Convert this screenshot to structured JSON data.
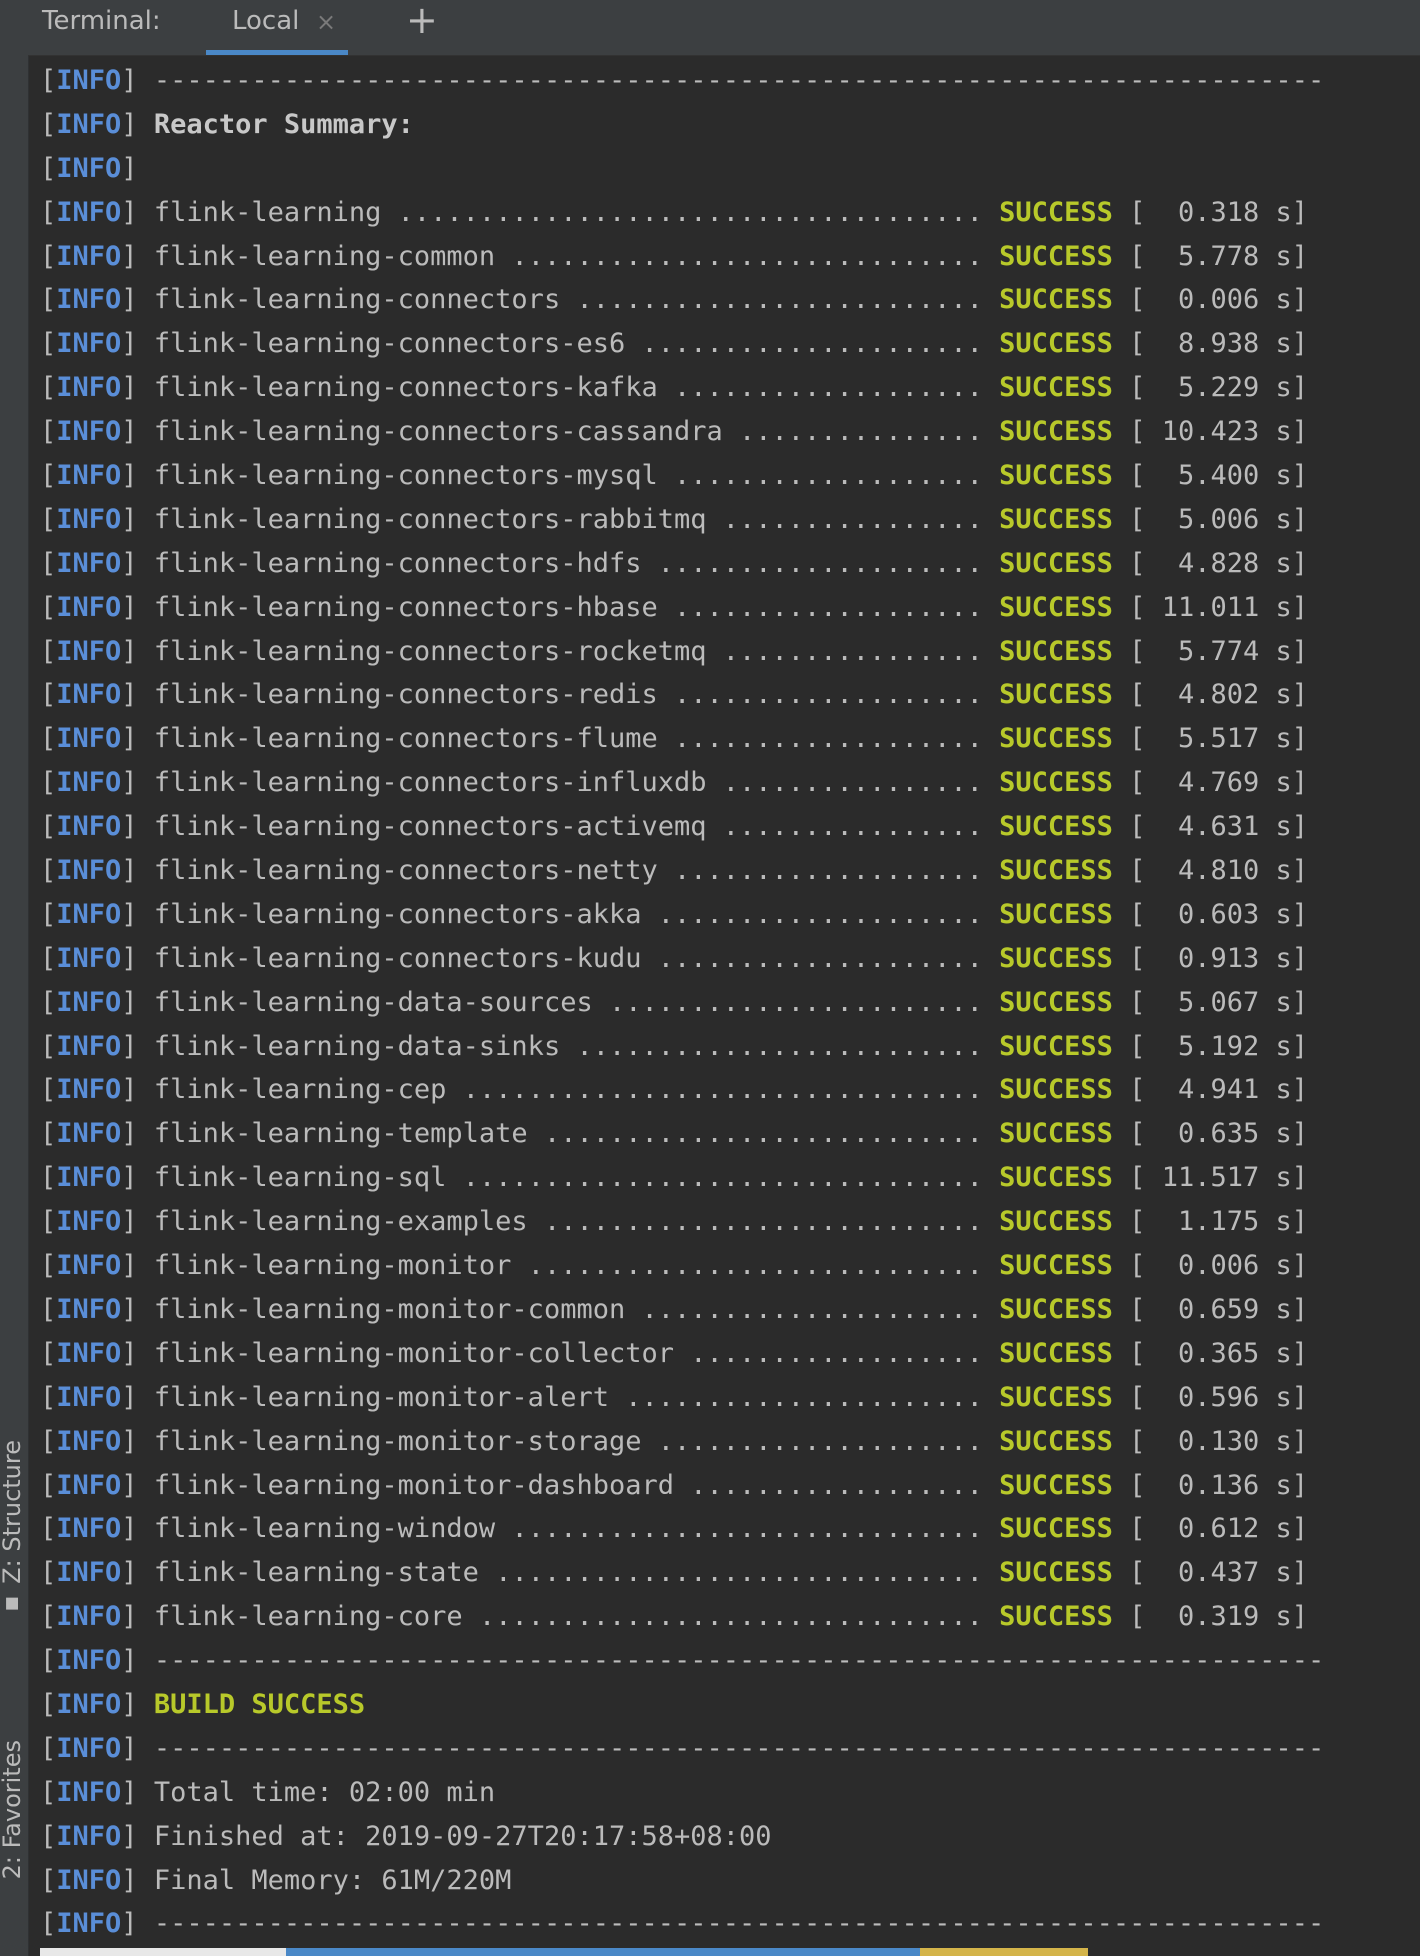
{
  "sidebar": {
    "structure_label": "Z: Structure",
    "favorites_label": "2: Favorites"
  },
  "tabbar": {
    "title": "Terminal:",
    "tab_label": "Local",
    "close_glyph": "×",
    "add_glyph": "+"
  },
  "console": {
    "info_tag": "INFO",
    "separator": "------------------------------------------------------------------------",
    "reactor_summary": "Reactor Summary:",
    "status": "SUCCESS",
    "modules": [
      {
        "name": "flink-learning",
        "dots": "....................................",
        "time": "  0.318 s"
      },
      {
        "name": "flink-learning-common",
        "dots": ".............................",
        "time": "  5.778 s"
      },
      {
        "name": "flink-learning-connectors",
        "dots": ".........................",
        "time": "  0.006 s"
      },
      {
        "name": "flink-learning-connectors-es6",
        "dots": ".....................",
        "time": "  8.938 s"
      },
      {
        "name": "flink-learning-connectors-kafka",
        "dots": "...................",
        "time": "  5.229 s"
      },
      {
        "name": "flink-learning-connectors-cassandra",
        "dots": "...............",
        "time": " 10.423 s"
      },
      {
        "name": "flink-learning-connectors-mysql",
        "dots": "...................",
        "time": "  5.400 s"
      },
      {
        "name": "flink-learning-connectors-rabbitmq",
        "dots": "................",
        "time": "  5.006 s"
      },
      {
        "name": "flink-learning-connectors-hdfs",
        "dots": "....................",
        "time": "  4.828 s"
      },
      {
        "name": "flink-learning-connectors-hbase",
        "dots": "...................",
        "time": " 11.011 s"
      },
      {
        "name": "flink-learning-connectors-rocketmq",
        "dots": "................",
        "time": "  5.774 s"
      },
      {
        "name": "flink-learning-connectors-redis",
        "dots": "...................",
        "time": "  4.802 s"
      },
      {
        "name": "flink-learning-connectors-flume",
        "dots": "...................",
        "time": "  5.517 s"
      },
      {
        "name": "flink-learning-connectors-influxdb",
        "dots": "................",
        "time": "  4.769 s"
      },
      {
        "name": "flink-learning-connectors-activemq",
        "dots": "................",
        "time": "  4.631 s"
      },
      {
        "name": "flink-learning-connectors-netty",
        "dots": "...................",
        "time": "  4.810 s"
      },
      {
        "name": "flink-learning-connectors-akka",
        "dots": "....................",
        "time": "  0.603 s"
      },
      {
        "name": "flink-learning-connectors-kudu",
        "dots": "....................",
        "time": "  0.913 s"
      },
      {
        "name": "flink-learning-data-sources",
        "dots": ".......................",
        "time": "  5.067 s"
      },
      {
        "name": "flink-learning-data-sinks",
        "dots": ".........................",
        "time": "  5.192 s"
      },
      {
        "name": "flink-learning-cep",
        "dots": "................................",
        "time": "  4.941 s"
      },
      {
        "name": "flink-learning-template",
        "dots": "...........................",
        "time": "  0.635 s"
      },
      {
        "name": "flink-learning-sql",
        "dots": "................................",
        "time": " 11.517 s"
      },
      {
        "name": "flink-learning-examples",
        "dots": "...........................",
        "time": "  1.175 s"
      },
      {
        "name": "flink-learning-monitor",
        "dots": "............................",
        "time": "  0.006 s"
      },
      {
        "name": "flink-learning-monitor-common",
        "dots": ".....................",
        "time": "  0.659 s"
      },
      {
        "name": "flink-learning-monitor-collector",
        "dots": "..................",
        "time": "  0.365 s"
      },
      {
        "name": "flink-learning-monitor-alert",
        "dots": "......................",
        "time": "  0.596 s"
      },
      {
        "name": "flink-learning-monitor-storage",
        "dots": "....................",
        "time": "  0.130 s"
      },
      {
        "name": "flink-learning-monitor-dashboard",
        "dots": "..................",
        "time": "  0.136 s"
      },
      {
        "name": "flink-learning-window",
        "dots": ".............................",
        "time": "  0.612 s"
      },
      {
        "name": "flink-learning-state",
        "dots": "..............................",
        "time": "  0.437 s"
      },
      {
        "name": "flink-learning-core",
        "dots": "...............................",
        "time": "  0.319 s"
      }
    ],
    "build_result": "BUILD SUCCESS",
    "total_time": "Total time: 02:00 min",
    "finished_at": "Finished at: 2019-09-27T20:17:58+08:00",
    "final_memory": "Final Memory: 61M/220M"
  },
  "colors": {
    "background": "#2b2b2b",
    "info": "#5a8ed8",
    "success": "#b8c92a",
    "text": "#bbbbbb",
    "tab_underline": "#4a88c7"
  },
  "statusbar_segments": [
    {
      "color": "#e8e8e8",
      "fraction": 0.19
    },
    {
      "color": "#4a88c7",
      "fraction": 0.49
    },
    {
      "color": "#d4b44a",
      "fraction": 0.13
    }
  ]
}
